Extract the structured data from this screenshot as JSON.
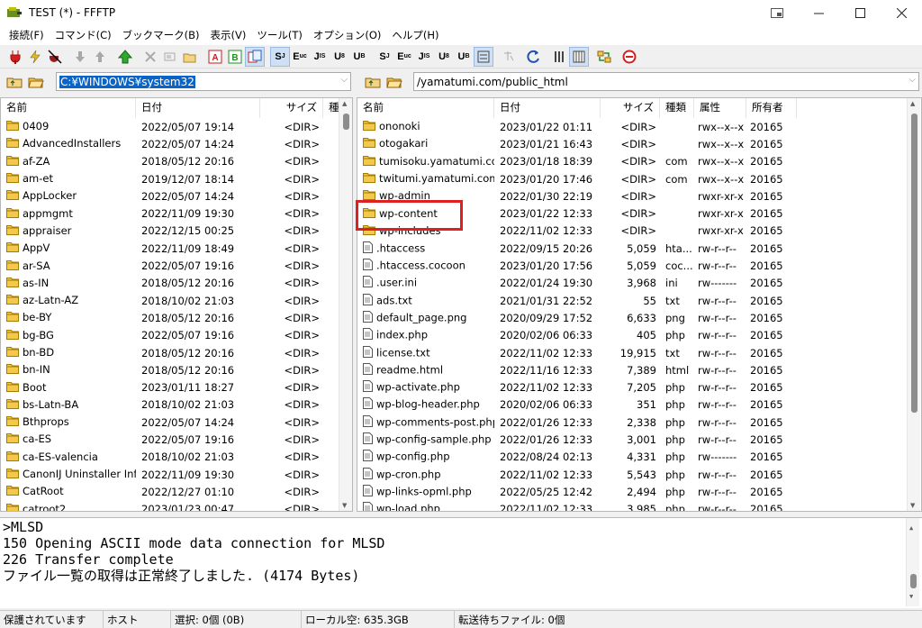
{
  "window": {
    "title": "TEST (*) - FFFTP"
  },
  "menu": [
    "接続(F)",
    "コマンド(C)",
    "ブックマーク(B)",
    "表示(V)",
    "ツール(T)",
    "オプション(O)",
    "ヘルプ(H)"
  ],
  "toolbar": {
    "icons": [
      "connect-icon",
      "quick-connect-icon",
      "disconnect-icon",
      "download-icon",
      "upload-icon",
      "mirror-upload-icon",
      "delete-icon",
      "rename-icon",
      "mkdir-icon",
      "ascii-mode-icon",
      "binary-mode-icon",
      "auto-mode-icon",
      "sjis-icon",
      "euc-icon",
      "jis-icon",
      "utf8-icon",
      "utf8-bom-icon",
      "sjis-name-icon",
      "euc-name-icon",
      "jis-name-icon",
      "utf8-name-icon",
      "utf8-bom-name-icon",
      "no-convert-icon",
      "kana-convert-icon",
      "refresh-icon",
      "list-view-icon",
      "detail-view-icon",
      "sync-folder-icon",
      "stop-icon"
    ]
  },
  "local": {
    "path": "C:¥WINDOWS¥system32",
    "columns": [
      "名前",
      "日付",
      "サイズ",
      "種類"
    ],
    "files": [
      [
        "0409",
        "2022/05/07 19:14",
        "<DIR>",
        ""
      ],
      [
        "AdvancedInstallers",
        "2022/05/07 14:24",
        "<DIR>",
        ""
      ],
      [
        "af-ZA",
        "2018/05/12 20:16",
        "<DIR>",
        ""
      ],
      [
        "am-et",
        "2019/12/07 18:14",
        "<DIR>",
        ""
      ],
      [
        "AppLocker",
        "2022/05/07 14:24",
        "<DIR>",
        ""
      ],
      [
        "appmgmt",
        "2022/11/09 19:30",
        "<DIR>",
        ""
      ],
      [
        "appraiser",
        "2022/12/15 00:25",
        "<DIR>",
        ""
      ],
      [
        "AppV",
        "2022/11/09 18:49",
        "<DIR>",
        ""
      ],
      [
        "ar-SA",
        "2022/05/07 19:16",
        "<DIR>",
        ""
      ],
      [
        "as-IN",
        "2018/05/12 20:16",
        "<DIR>",
        ""
      ],
      [
        "az-Latn-AZ",
        "2018/10/02 21:03",
        "<DIR>",
        ""
      ],
      [
        "be-BY",
        "2018/05/12 20:16",
        "<DIR>",
        ""
      ],
      [
        "bg-BG",
        "2022/05/07 19:16",
        "<DIR>",
        ""
      ],
      [
        "bn-BD",
        "2018/05/12 20:16",
        "<DIR>",
        ""
      ],
      [
        "bn-IN",
        "2018/05/12 20:16",
        "<DIR>",
        ""
      ],
      [
        "Boot",
        "2023/01/11 18:27",
        "<DIR>",
        ""
      ],
      [
        "bs-Latn-BA",
        "2018/10/02 21:03",
        "<DIR>",
        ""
      ],
      [
        "Bthprops",
        "2022/05/07 14:24",
        "<DIR>",
        ""
      ],
      [
        "ca-ES",
        "2022/05/07 19:16",
        "<DIR>",
        ""
      ],
      [
        "ca-ES-valencia",
        "2018/10/02 21:03",
        "<DIR>",
        ""
      ],
      [
        "CanonIJ Uninstaller Inf...",
        "2022/11/09 19:30",
        "<DIR>",
        ""
      ],
      [
        "CatRoot",
        "2022/12/27 01:10",
        "<DIR>",
        ""
      ],
      [
        "catroot2",
        "2023/01/23 00:47",
        "<DIR>",
        ""
      ]
    ]
  },
  "remote": {
    "path": "/yamatumi.com/public_html",
    "columns": [
      "名前",
      "日付",
      "サイズ",
      "種類",
      "属性",
      "所有者"
    ],
    "files": [
      [
        "ononoki",
        "2023/01/22 01:11",
        "<DIR>",
        "",
        "rwx--x--x",
        "20165",
        "folder"
      ],
      [
        "otogakari",
        "2023/01/21 16:43",
        "<DIR>",
        "",
        "rwx--x--x",
        "20165",
        "folder"
      ],
      [
        "tumisoku.yamatumi.co...",
        "2023/01/18 18:39",
        "<DIR>",
        "com",
        "rwx--x--x",
        "20165",
        "folder"
      ],
      [
        "twitumi.yamatumi.com",
        "2023/01/20 17:46",
        "<DIR>",
        "com",
        "rwx--x--x",
        "20165",
        "folder"
      ],
      [
        "wp-admin",
        "2022/01/30 22:19",
        "<DIR>",
        "",
        "rwxr-xr-x",
        "20165",
        "folder"
      ],
      [
        "wp-content",
        "2023/01/22 12:33",
        "<DIR>",
        "",
        "rwxr-xr-x",
        "20165",
        "folder"
      ],
      [
        "wp-includes",
        "2022/11/02 12:33",
        "<DIR>",
        "",
        "rwxr-xr-x",
        "20165",
        "folder"
      ],
      [
        ".htaccess",
        "2022/09/15 20:26",
        "5,059",
        "hta...",
        "rw-r--r--",
        "20165",
        "file"
      ],
      [
        ".htaccess.cocoon",
        "2023/01/20 17:56",
        "5,059",
        "coc...",
        "rw-r--r--",
        "20165",
        "file"
      ],
      [
        ".user.ini",
        "2022/01/24 19:30",
        "3,968",
        "ini",
        "rw-------",
        "20165",
        "file"
      ],
      [
        "ads.txt",
        "2021/01/31 22:52",
        "55",
        "txt",
        "rw-r--r--",
        "20165",
        "file"
      ],
      [
        "default_page.png",
        "2020/09/29 17:52",
        "6,633",
        "png",
        "rw-r--r--",
        "20165",
        "file"
      ],
      [
        "index.php",
        "2020/02/06 06:33",
        "405",
        "php",
        "rw-r--r--",
        "20165",
        "file"
      ],
      [
        "license.txt",
        "2022/11/02 12:33",
        "19,915",
        "txt",
        "rw-r--r--",
        "20165",
        "file"
      ],
      [
        "readme.html",
        "2022/11/16 12:33",
        "7,389",
        "html",
        "rw-r--r--",
        "20165",
        "file"
      ],
      [
        "wp-activate.php",
        "2022/11/02 12:33",
        "7,205",
        "php",
        "rw-r--r--",
        "20165",
        "file"
      ],
      [
        "wp-blog-header.php",
        "2020/02/06 06:33",
        "351",
        "php",
        "rw-r--r--",
        "20165",
        "file"
      ],
      [
        "wp-comments-post.php",
        "2022/01/26 12:33",
        "2,338",
        "php",
        "rw-r--r--",
        "20165",
        "file"
      ],
      [
        "wp-config-sample.php",
        "2022/01/26 12:33",
        "3,001",
        "php",
        "rw-r--r--",
        "20165",
        "file"
      ],
      [
        "wp-config.php",
        "2022/08/24 02:13",
        "4,331",
        "php",
        "rw-------",
        "20165",
        "file"
      ],
      [
        "wp-cron.php",
        "2022/11/02 12:33",
        "5,543",
        "php",
        "rw-r--r--",
        "20165",
        "file"
      ],
      [
        "wp-links-opml.php",
        "2022/05/25 12:42",
        "2,494",
        "php",
        "rw-r--r--",
        "20165",
        "file"
      ],
      [
        "wp-load.php",
        "2022/11/02 12:33",
        "3,985",
        "php",
        "rw-r--r--",
        "20165",
        "file"
      ]
    ]
  },
  "log": [
    ">MLSD",
    "150 Opening ASCII mode data connection for MLSD",
    "226 Transfer complete",
    "ファイル一覧の取得は正常終了しました. (4174 Bytes)"
  ],
  "status": {
    "security": "保護されています",
    "host": "ホスト",
    "selection": "選択: 0個 (0B)",
    "local_free": "ローカル空: 635.3GB",
    "pending": "転送待ちファイル: 0個"
  },
  "colors": {
    "highlight": "#e02020",
    "selection": "#0a64c8",
    "folder": "#f2c94c"
  }
}
